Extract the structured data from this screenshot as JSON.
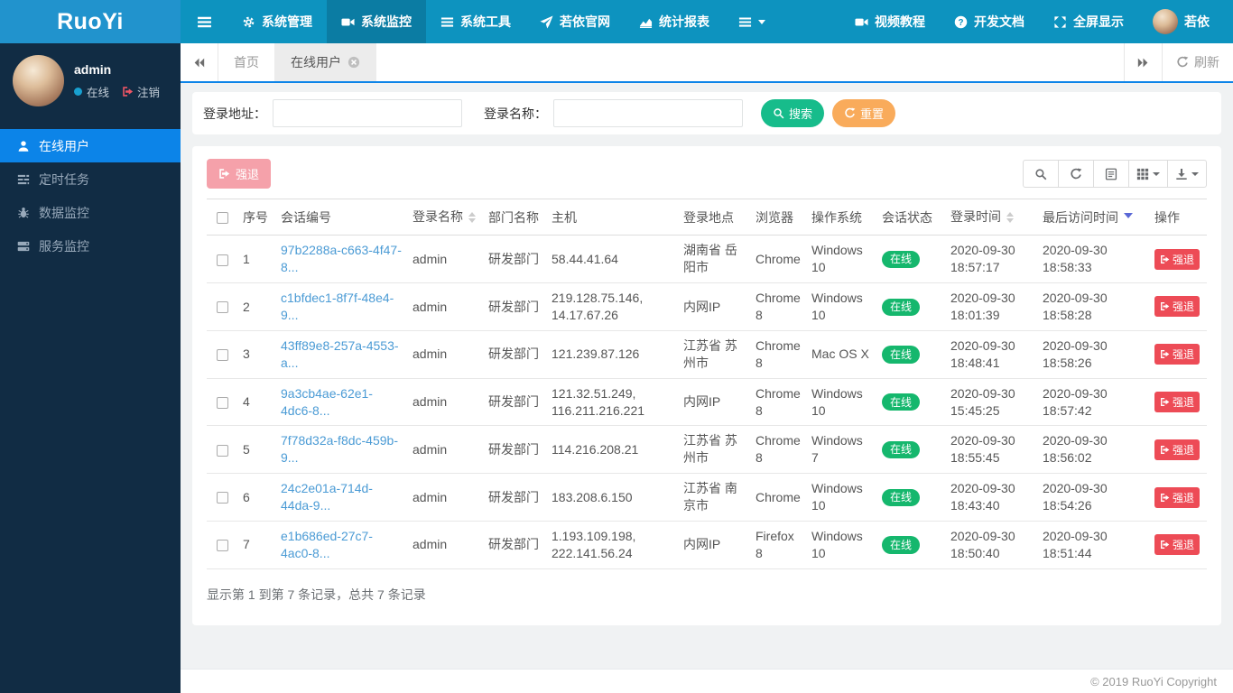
{
  "palette": {
    "topbar_brand": "#2193cd",
    "topbar_nav": "#0d93bf",
    "topbar_active": "#0b7ca3",
    "sidebar_bg": "#112c44",
    "sidebar_active_blue": "#0c84e8",
    "link_blue": "#4b9bd5",
    "search_green": "#17bc8b",
    "badge_green": "#15b76d",
    "reset_orange": "#f9ab5b",
    "danger_red": "#ed4b56"
  },
  "app": {
    "brand": "RuoYi",
    "copyright": "© 2019 RuoYi Copyright"
  },
  "topnav": {
    "menu": [
      {
        "name": "system-manage",
        "label": "系统管理",
        "icon": "gear-icon"
      },
      {
        "name": "system-monitor",
        "label": "系统监控",
        "icon": "video-icon",
        "active": true
      },
      {
        "name": "system-tools",
        "label": "系统工具",
        "icon": "list-icon"
      },
      {
        "name": "ruoyi-site",
        "label": "若依官网",
        "icon": "paper-plane-icon"
      },
      {
        "name": "stats-report",
        "label": "统计报表",
        "icon": "chart-icon"
      },
      {
        "name": "more",
        "label": "",
        "icon": "menu-icon",
        "caret": true
      }
    ],
    "right": [
      {
        "name": "video-tutorial",
        "label": "视频教程",
        "icon": "video-icon"
      },
      {
        "name": "dev-docs",
        "label": "开发文档",
        "icon": "question-icon"
      },
      {
        "name": "fullscreen",
        "label": "全屏显示",
        "icon": "expand-icon"
      },
      {
        "name": "profile",
        "label": "若依",
        "icon": "avatar"
      }
    ]
  },
  "sidebar": {
    "user": {
      "name": "admin",
      "status": "在线",
      "logout": "注销"
    },
    "menu": [
      {
        "name": "online-users",
        "label": "在线用户",
        "icon": "user-icon",
        "active": true
      },
      {
        "name": "scheduled-tasks",
        "label": "定时任务",
        "icon": "tasks-icon"
      },
      {
        "name": "data-monitor",
        "label": "数据监控",
        "icon": "bug-icon"
      },
      {
        "name": "service-monitor",
        "label": "服务监控",
        "icon": "server-icon"
      }
    ]
  },
  "tabs": {
    "items": [
      {
        "name": "home",
        "label": "首页"
      },
      {
        "name": "online-users",
        "label": "在线用户",
        "active": true,
        "closable": true
      }
    ],
    "refresh_label": "刷新"
  },
  "search": {
    "address_label": "登录地址：",
    "address_value": "",
    "name_label": "登录名称：",
    "name_value": "",
    "search_button": "搜索",
    "reset_button": "重置"
  },
  "toolbar": {
    "force_logout_button": "强退",
    "buttons": [
      {
        "name": "search-toggle",
        "icon": "search-icon"
      },
      {
        "name": "refresh-table",
        "icon": "refresh-icon"
      },
      {
        "name": "detail-view",
        "icon": "detail-icon"
      },
      {
        "name": "columns",
        "icon": "grid-icon",
        "caret": true
      },
      {
        "name": "export",
        "icon": "download-icon",
        "caret": true
      }
    ]
  },
  "table": {
    "columns": [
      {
        "name": "select-all",
        "label": "",
        "type": "checkbox"
      },
      {
        "name": "index",
        "label": "序号"
      },
      {
        "name": "session-id",
        "label": "会话编号"
      },
      {
        "name": "login-name",
        "label": "登录名称",
        "sort": "both"
      },
      {
        "name": "dept-name",
        "label": "部门名称"
      },
      {
        "name": "host",
        "label": "主机"
      },
      {
        "name": "login-location",
        "label": "登录地点"
      },
      {
        "name": "browser",
        "label": "浏览器"
      },
      {
        "name": "os",
        "label": "操作系统"
      },
      {
        "name": "session-status",
        "label": "会话状态"
      },
      {
        "name": "login-time",
        "label": "登录时间",
        "sort": "both"
      },
      {
        "name": "last-access-time",
        "label": "最后访问时间",
        "sort": "desc"
      },
      {
        "name": "actions",
        "label": "操作"
      }
    ],
    "action_label": "强退",
    "rows": [
      {
        "index": "1",
        "session_id": "97b2288a-c663-4f47-8...",
        "login_name": "admin",
        "dept": "研发部门",
        "host": "58.44.41.64",
        "location": "湖南省 岳阳市",
        "browser": "Chrome",
        "os": "Windows 10",
        "status": "在线",
        "login_time": "2020-09-30 18:57:17",
        "last_access": "2020-09-30 18:58:33"
      },
      {
        "index": "2",
        "session_id": "c1bfdec1-8f7f-48e4-9...",
        "login_name": "admin",
        "dept": "研发部门",
        "host": "219.128.75.146, 14.17.67.26",
        "location": "内网IP",
        "browser": "Chrome 8",
        "os": "Windows 10",
        "status": "在线",
        "login_time": "2020-09-30 18:01:39",
        "last_access": "2020-09-30 18:58:28"
      },
      {
        "index": "3",
        "session_id": "43ff89e8-257a-4553-a...",
        "login_name": "admin",
        "dept": "研发部门",
        "host": "121.239.87.126",
        "location": "江苏省 苏州市",
        "browser": "Chrome 8",
        "os": "Mac OS X",
        "status": "在线",
        "login_time": "2020-09-30 18:48:41",
        "last_access": "2020-09-30 18:58:26"
      },
      {
        "index": "4",
        "session_id": "9a3cb4ae-62e1-4dc6-8...",
        "login_name": "admin",
        "dept": "研发部门",
        "host": "121.32.51.249, 116.211.216.221",
        "location": "内网IP",
        "browser": "Chrome 8",
        "os": "Windows 10",
        "status": "在线",
        "login_time": "2020-09-30 15:45:25",
        "last_access": "2020-09-30 18:57:42"
      },
      {
        "index": "5",
        "session_id": "7f78d32a-f8dc-459b-9...",
        "login_name": "admin",
        "dept": "研发部门",
        "host": "114.216.208.21",
        "location": "江苏省 苏州市",
        "browser": "Chrome 8",
        "os": "Windows 7",
        "status": "在线",
        "login_time": "2020-09-30 18:55:45",
        "last_access": "2020-09-30 18:56:02"
      },
      {
        "index": "6",
        "session_id": "24c2e01a-714d-44da-9...",
        "login_name": "admin",
        "dept": "研发部门",
        "host": "183.208.6.150",
        "location": "江苏省 南京市",
        "browser": "Chrome",
        "os": "Windows 10",
        "status": "在线",
        "login_time": "2020-09-30 18:43:40",
        "last_access": "2020-09-30 18:54:26"
      },
      {
        "index": "7",
        "session_id": "e1b686ed-27c7-4ac0-8...",
        "login_name": "admin",
        "dept": "研发部门",
        "host": "1.193.109.198, 222.141.56.24",
        "location": "内网IP",
        "browser": "Firefox 8",
        "os": "Windows 10",
        "status": "在线",
        "login_time": "2020-09-30 18:50:40",
        "last_access": "2020-09-30 18:51:44"
      }
    ]
  },
  "pagination": {
    "summary": "显示第 1 到第 7 条记录，总共 7 条记录"
  }
}
